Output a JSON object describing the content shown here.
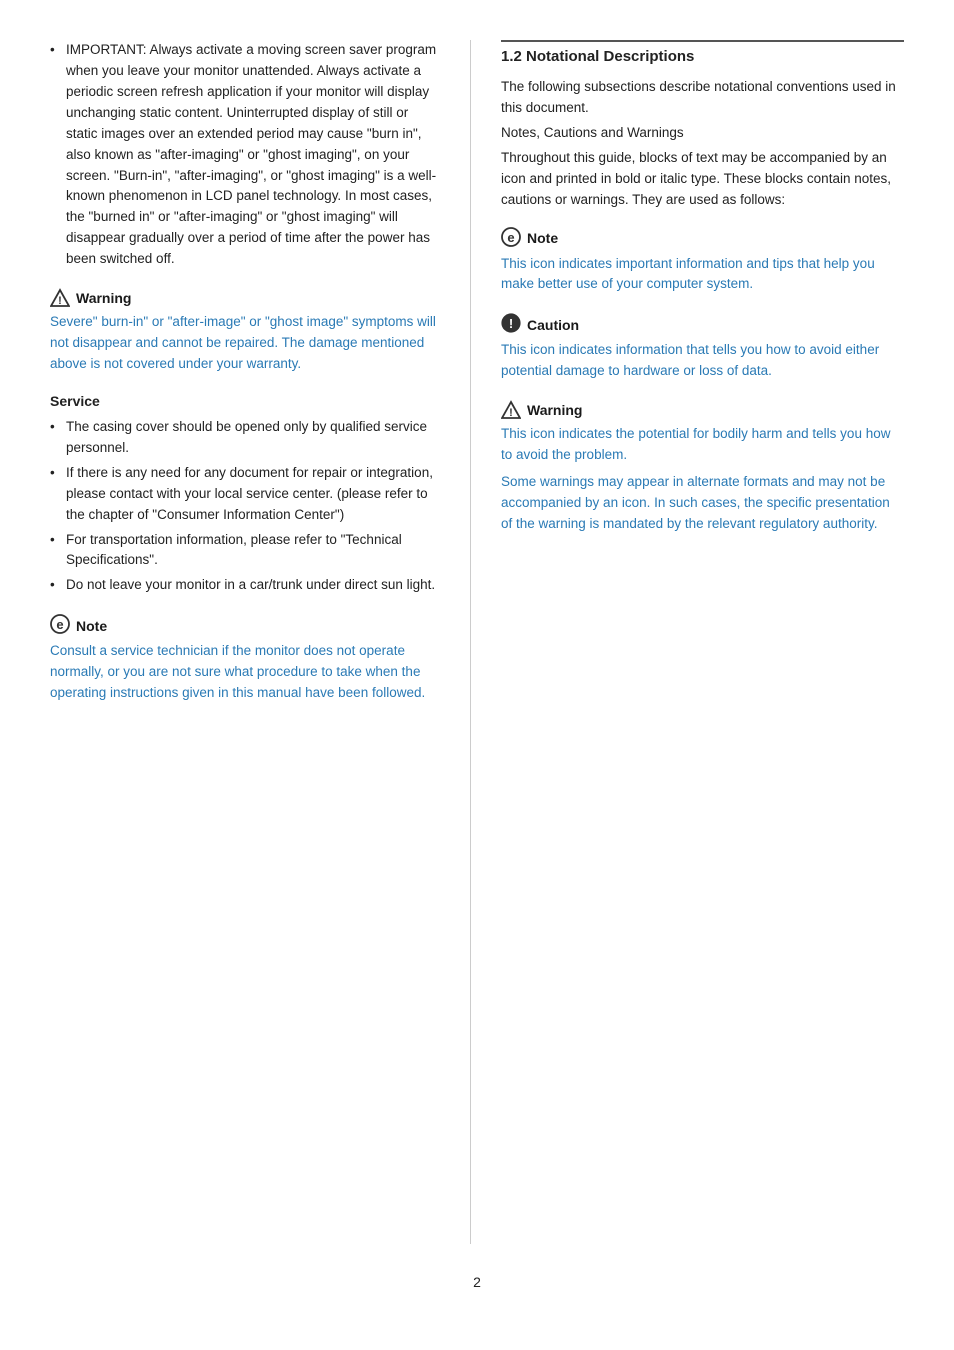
{
  "left": {
    "intro_bullet": "IMPORTANT: Always activate a moving screen saver program when you leave your monitor unattended. Always activate a periodic screen refresh application if your monitor will display unchanging static content. Uninterrupted display of still or static images over an extended period may cause \"burn in\", also known as \"after-imaging\" or \"ghost imaging\", on your screen. \"Burn-in\", \"after-imaging\", or \"ghost imaging\" is a well-known phenomenon in LCD panel technology. In most cases, the \"burned in\" or \"after-imaging\" or \"ghost imaging\" will disappear gradually over a period of time after the power has been switched off.",
    "warning_label": "Warning",
    "warning_text": "Severe\" burn-in\" or \"after-image\" or \"ghost image\" symptoms will not disappear and cannot be repaired. The damage mentioned above is not covered under your warranty.",
    "service_heading": "Service",
    "service_items": [
      "The casing cover should be opened only by qualified service personnel.",
      "If there is any need for any document for repair or integration, please contact with your local service center. (please refer to the chapter of \"Consumer Information Center\")",
      "For transportation information, please refer to \"Technical Specifications\".",
      "Do not leave your monitor in a car/trunk under direct sun light."
    ],
    "note_label": "Note",
    "note_text": "Consult a service technician if the monitor does not operate normally, or you are not sure what procedure to take when the operating instructions given in this manual have been followed."
  },
  "right": {
    "section_title": "1.2 Notational Descriptions",
    "intro_text": "The following subsections describe notational conventions used in this document.",
    "notes_cautions_warnings": "Notes, Cautions and Warnings",
    "guide_text": "Throughout this guide, blocks of text may be accompanied by an icon and printed in bold or italic type. These blocks contain notes, cautions or warnings. They are used as follows:",
    "note_label": "Note",
    "note_text": "This icon indicates important information and tips that help you make better use of your computer system.",
    "caution_label": "Caution",
    "caution_text": "This icon indicates information that tells you how to avoid either potential damage to hardware or loss of data.",
    "warning_label": "Warning",
    "warning_text_1": "This icon indicates the potential for bodily harm and tells you how to avoid the problem.",
    "warning_text_2": "Some warnings may appear in alternate formats and may not be accompanied by an icon. In such cases, the specific presentation of the warning is mandated by the relevant regulatory authority."
  },
  "page_number": "2"
}
